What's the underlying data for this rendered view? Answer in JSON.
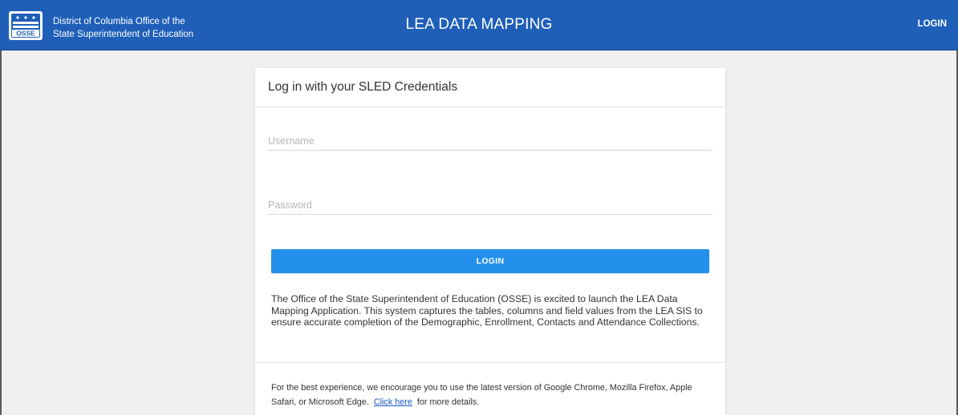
{
  "header": {
    "org_line1": "District of Columbia Office of the",
    "org_line2": "State Superintendent of Education",
    "logo_text": "OSSE",
    "app_title": "LEA DATA MAPPING",
    "login_link": "LOGIN",
    "background_color": "#1f5fb8"
  },
  "login_card": {
    "title": "Log in with your SLED Credentials",
    "username_placeholder": "Username",
    "username_value": "",
    "password_placeholder": "Password",
    "password_value": "",
    "login_button": "LOGIN",
    "button_color": "#2391ec",
    "intro_text": "The Office of the State Superintendent of Education (OSSE) is excited to launch the LEA Data Mapping Application. This system captures the tables, columns and field values from the LEA SIS to ensure accurate completion of the Demographic, Enrollment, Contacts and Attendance Collections.",
    "browser_note_before": "For the best experience, we encourage you to use the latest version of Google Chrome, Mozilla Firefox, Apple Safari, or Microsoft Edge.",
    "browser_note_link": "Click here",
    "browser_note_after": "for more details."
  }
}
